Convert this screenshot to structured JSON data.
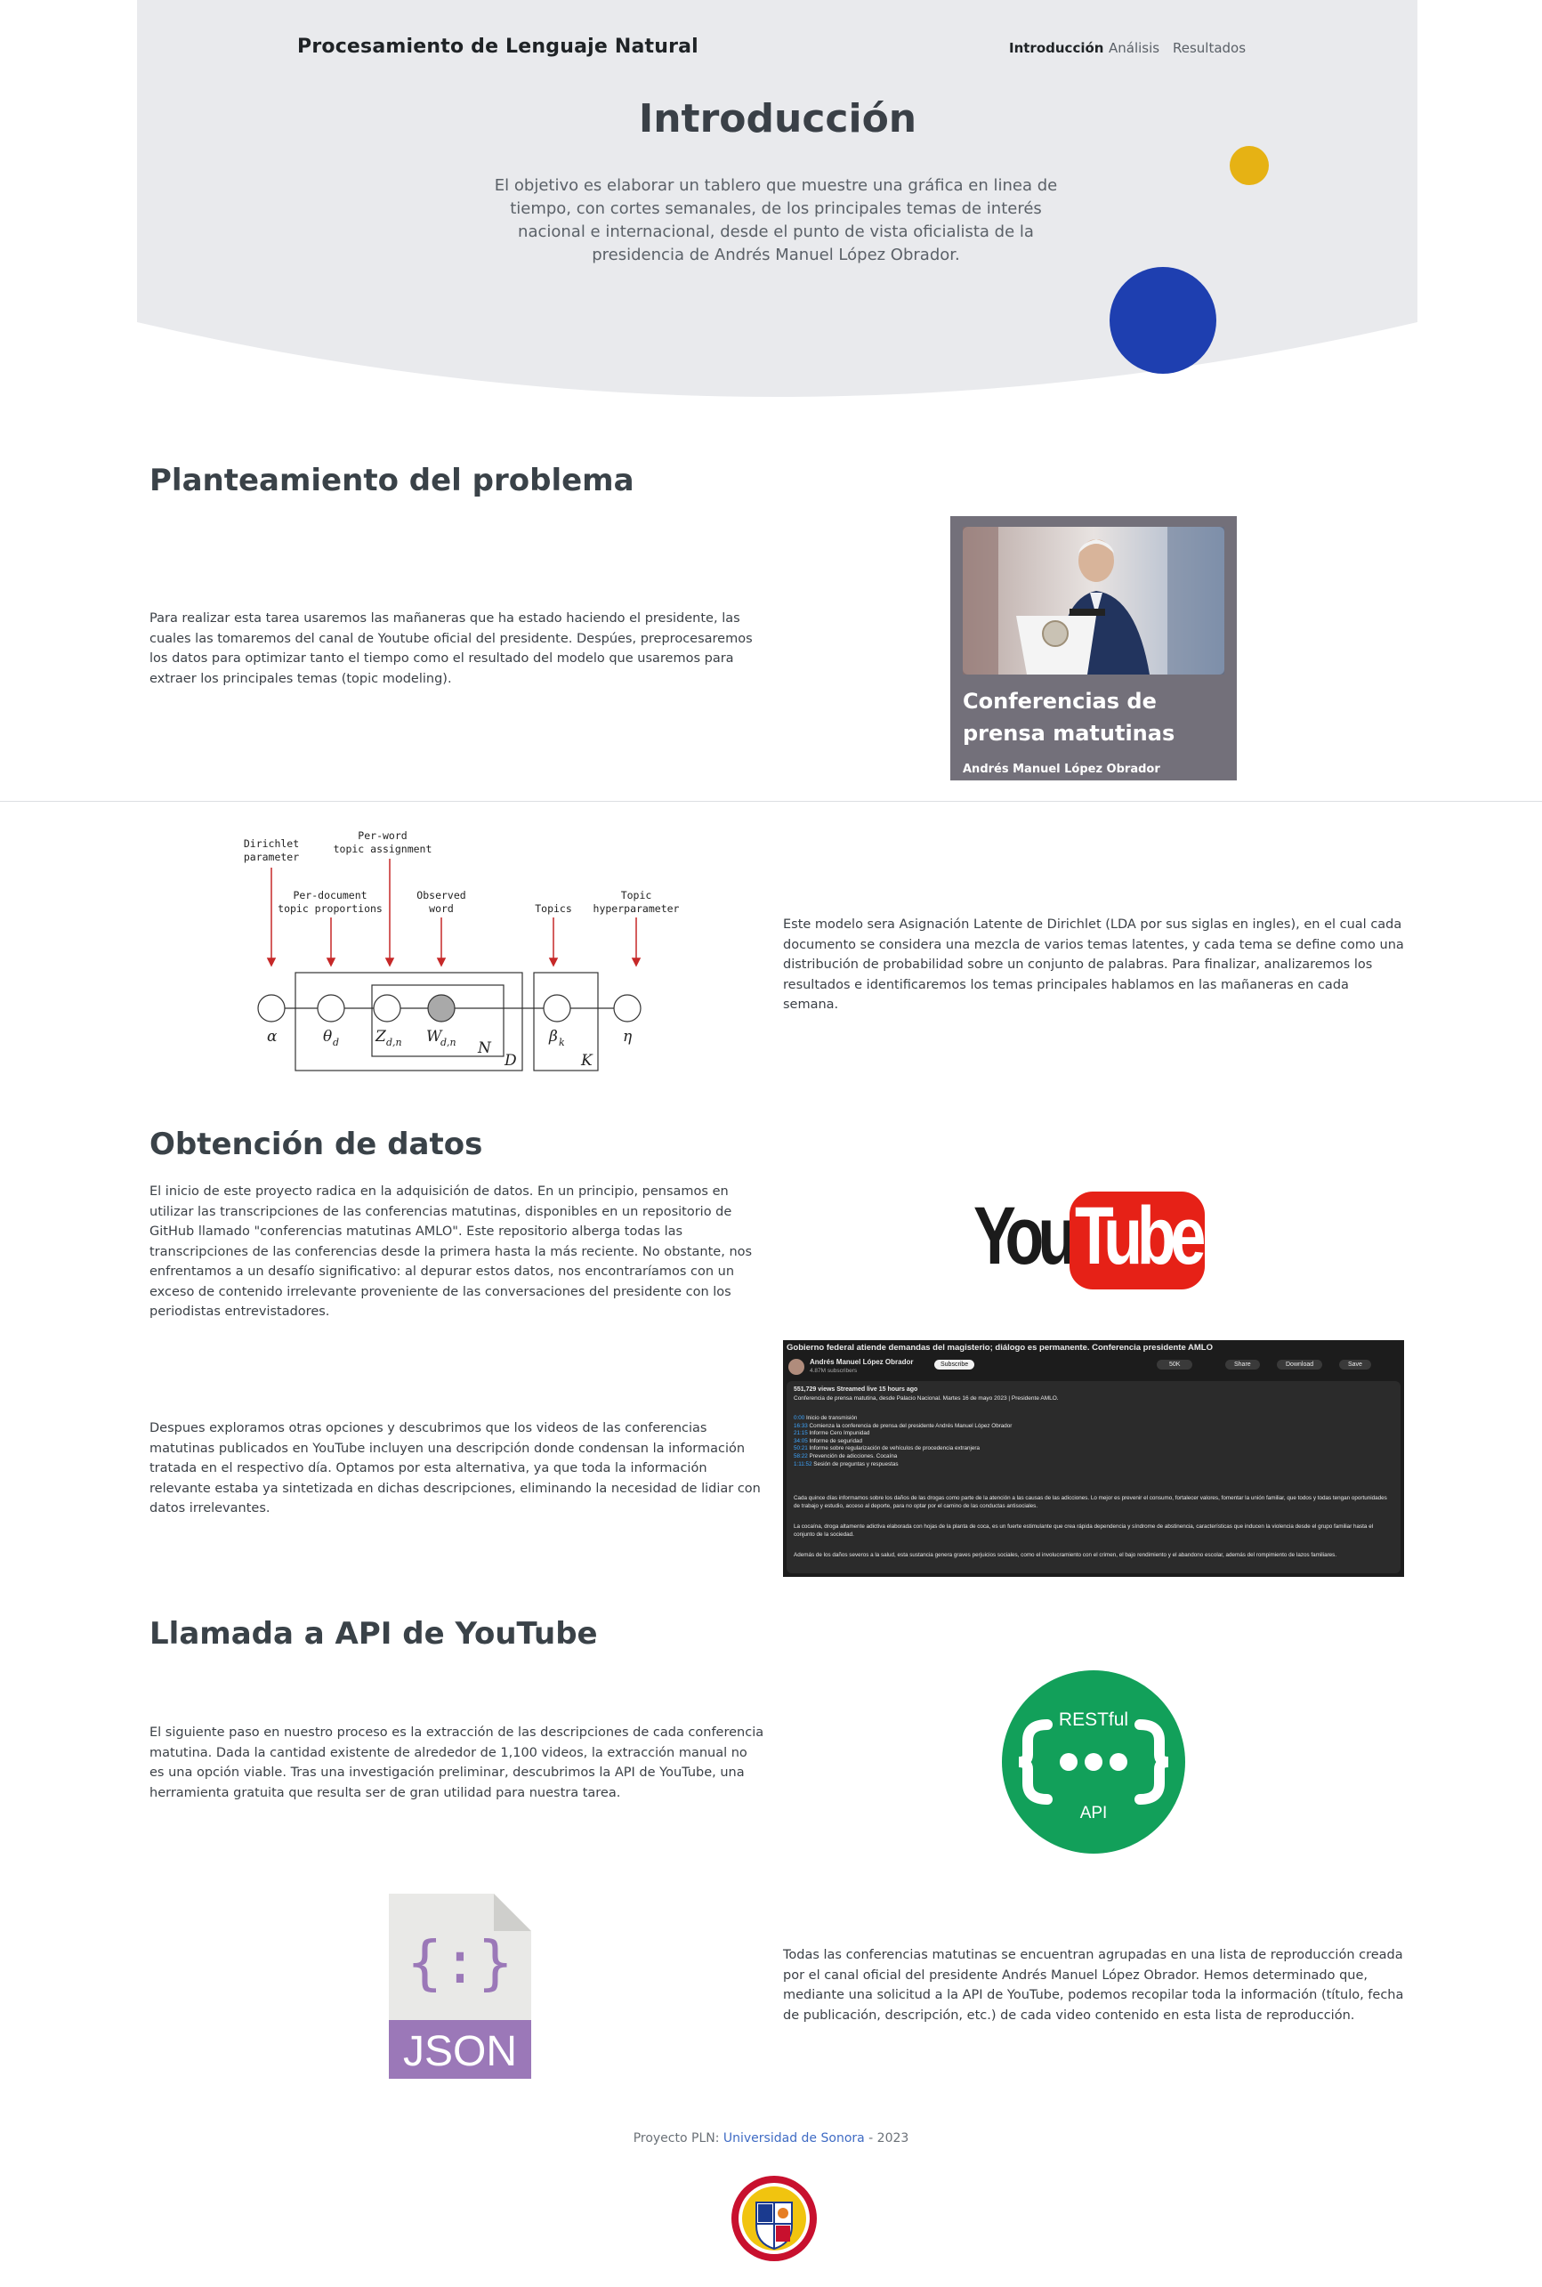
{
  "header": {
    "site_title": "Procesamiento de Lenguaje Natural",
    "nav": [
      "Introducción",
      "Análisis",
      "Resultados"
    ],
    "title": "Introducción",
    "description": "El objetivo es elaborar un tablero que muestre una gráfica en linea de tiempo, con cortes semanales, de los principales temas de interés nacional e internacional, desde el punto de vista oficialista de la presidencia de Andrés Manuel López Obrador."
  },
  "problem": {
    "heading": "Planteamiento del problema",
    "text": "Para realizar esta tarea usaremos las mañaneras que ha estado haciendo el presidente, las cuales las tomaremos del canal de Youtube oficial del presidente. Despúes, preprocesaremos los datos para optimizar tanto el tiempo como el resultado del modelo que usaremos para extraer los principales temas (topic modeling).",
    "card_title": "Conferencias de prensa matutinas",
    "card_subtitle": "Andrés Manuel López Obrador"
  },
  "lda": {
    "text": "Este modelo sera Asignación Latente de Dirichlet (LDA por sus siglas en ingles), en el cual cada documento se considera una mezcla de varios temas latentes, y cada tema se define como una distribución de probabilidad sobre un conjunto de palabras. Para finalizar, analizaremos los resultados e identificaremos los temas principales hablamos en las mañaneras en cada semana.",
    "labels": {
      "dirichlet": [
        "Dirichlet",
        "parameter"
      ],
      "per_word": [
        "Per-word",
        "topic assignment"
      ],
      "per_document": [
        "Per-document",
        "topic proportions"
      ],
      "observed": [
        "Observed",
        "word"
      ],
      "topics": [
        "Topics"
      ],
      "topic_hyper": [
        "Topic",
        "hyperparameter"
      ]
    },
    "symbols": {
      "alpha": "α",
      "theta": "θ",
      "theta_sub": "d",
      "z": "Z",
      "z_sub": "d,n",
      "w": "W",
      "w_sub": "d,n",
      "beta": "β",
      "beta_sub": "k",
      "eta": "η",
      "N": "N",
      "D": "D",
      "K": "K"
    }
  },
  "data": {
    "heading": "Obtención de datos",
    "text1": "El inicio de este proyecto radica en la adquisición de datos. En un principio, pensamos en utilizar las transcripciones de las conferencias matutinas, disponibles en un repositorio de GitHub llamado \"conferencias matutinas AMLO\". Este repositorio alberga todas las transcripciones de las conferencias desde la primera hasta la más reciente. No obstante, nos enfrentamos a un desafío significativo: al depurar estos datos, nos encontraríamos con un exceso de contenido irrelevante proveniente de las conversaciones del presidente con los periodistas entrevistadores.",
    "text2": "Despues exploramos otras opciones y descubrimos que los videos de las conferencias matutinas publicados en YouTube incluyen una descripción donde condensan la información tratada en el respectivo día. Optamos por esta alternativa, ya que toda la información relevante estaba ya sintetizada en dichas descripciones, eliminando la necesidad de lidiar con datos irrelevantes.",
    "youtube_you": "You",
    "youtube_tube": "Tube",
    "yt_screenshot": {
      "title": "Gobierno federal atiende demandas del magisterio; diálogo es permanente. Conferencia presidente AMLO",
      "channel": "Andrés Manuel López Obrador",
      "subscribers": "4.87M subscribers",
      "subscribe": "Subscribe",
      "likes": "50K",
      "share": "Share",
      "download": "Download",
      "save": "Save",
      "stats": "551,729 views  Streamed live 15 hours ago",
      "desc": "Conferencia de prensa matutina, desde Palacio Nacional. Martes 16 de mayo 2023 | Presidente AMLO.",
      "chapters": [
        {
          "time": "0:00",
          "label": "Inicio de transmisión"
        },
        {
          "time": "16:33",
          "label": "Comienza la conferencia de prensa del presidente Andrés Manuel López Obrador"
        },
        {
          "time": "21:15",
          "label": "Informe Cero Impunidad"
        },
        {
          "time": "34:05",
          "label": "Informe de seguridad"
        },
        {
          "time": "50:21",
          "label": "Informe sobre regularización de vehículos de procedencia extranjera"
        },
        {
          "time": "58:22",
          "label": "Prevención de adicciones. Cocaína"
        },
        {
          "time": "1:11:52",
          "label": "Sesión de preguntas y respuestas"
        }
      ],
      "para1": "Cada quince días informamos sobre los daños de las drogas como parte de la atención a las causas de las adicciones. Lo mejor es prevenir el consumo, fortalecer valores, fomentar la unión familiar, que todos y todas tengan oportunidades de trabajo y estudio, acceso al deporte, para no optar por el camino de las conductas antisociales.",
      "para2": "La cocaína, droga altamente adictiva elaborada con hojas de la planta de coca, es un fuerte estimulante que crea rápida dependencia y síndrome de abstinencia, características que inducen la violencia desde el grupo familiar hasta el conjunto de la sociedad.",
      "para3": "Además de los daños severos a la salud, esta sustancia genera graves perjuicios sociales, como el involucramiento con el crimen, el bajo rendimiento y el abandono escolar, además del rompimiento de lazos familiares."
    }
  },
  "api": {
    "heading": "Llamada a API de YouTube",
    "text1": "El siguiente paso en nuestro proceso es la extracción de las descripciones de cada conferencia matutina. Dada la cantidad existente de alrededor de 1,100 videos, la extracción manual no es una opción viable. Tras una investigación preliminar, descubrimos la API de YouTube, una herramienta gratuita que resulta ser de gran utilidad para nuestra tarea.",
    "restful": "RESTful",
    "api_label": "API",
    "json_label": "JSON",
    "json_glyph": "{:}",
    "text2": "Todas las conferencias matutinas se encuentran agrupadas en una lista de reproducción creada por el canal oficial del presidente Andrés Manuel López Obrador. Hemos determinado que, mediante una solicitud a la API de YouTube, podemos recopilar toda la información (título, fecha de publicación, descripción, etc.) de cada video contenido en esta lista de reproducción."
  },
  "footer": {
    "prefix": "Proyecto PLN: ",
    "link": "Universidad de Sonora",
    "suffix": " - 2023"
  },
  "colors": {
    "hero_bg": "#e9eaed",
    "yellow_dot": "#e6b214",
    "blue_dot": "#1e3fb0",
    "youtube_red": "#e62117",
    "restful_green": "#12a05a",
    "json_purple": "#9b78b8",
    "link_blue": "#3f6bc4"
  },
  "icons": [
    "youtube-logo-icon",
    "restful-api-icon",
    "json-file-icon",
    "university-seal-icon"
  ]
}
